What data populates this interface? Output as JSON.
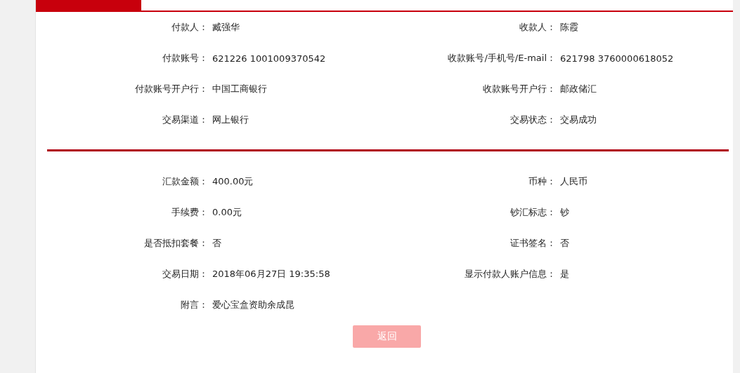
{
  "sections": [
    {
      "rows": [
        {
          "left": {
            "label": "付款人：",
            "value": "臧强华"
          },
          "right": {
            "label": "收款人：",
            "value": "陈霞"
          }
        },
        {
          "left": {
            "label": "付款账号：",
            "value": "621226 1001009370542"
          },
          "right": {
            "label": "收款账号/手机号/E-mail：",
            "value": "621798 3760000618052"
          }
        },
        {
          "left": {
            "label": "付款账号开户行：",
            "value": "中国工商银行"
          },
          "right": {
            "label": "收款账号开户行：",
            "value": "邮政储汇"
          }
        },
        {
          "left": {
            "label": "交易渠道：",
            "value": "网上银行"
          },
          "right": {
            "label": "交易状态：",
            "value": "交易成功"
          }
        }
      ]
    },
    {
      "rows": [
        {
          "left": {
            "label": "汇款金额：",
            "value": "400.00元"
          },
          "right": {
            "label": "币种：",
            "value": "人民币"
          }
        },
        {
          "left": {
            "label": "手续费：",
            "value": "0.00元"
          },
          "right": {
            "label": "钞汇标志：",
            "value": "钞"
          }
        },
        {
          "left": {
            "label": "是否抵扣套餐：",
            "value": "否"
          },
          "right": {
            "label": "证书签名：",
            "value": "否"
          }
        },
        {
          "left": {
            "label": "交易日期：",
            "value": "2018年06月27日 19:35:58"
          },
          "right": {
            "label": "显示付款人账户信息：",
            "value": "是"
          }
        },
        {
          "left": {
            "label": "附言：",
            "value": "爱心宝盒资助余成昆"
          }
        }
      ]
    }
  ],
  "button": {
    "label": "返回"
  }
}
